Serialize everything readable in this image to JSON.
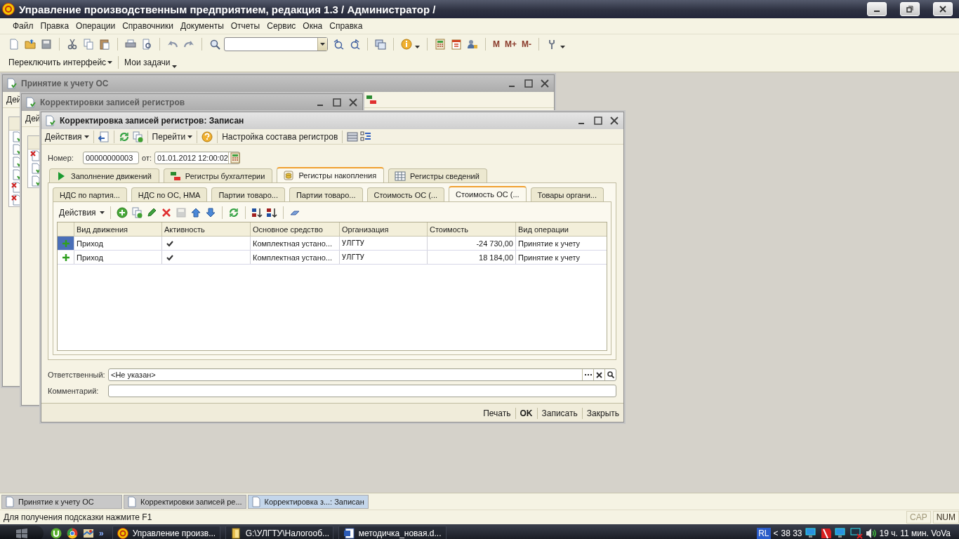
{
  "app": {
    "title": "Управление производственным предприятием, редакция 1.3 / Администратор /"
  },
  "menu": [
    "Файл",
    "Правка",
    "Операции",
    "Справочники",
    "Документы",
    "Отчеты",
    "Сервис",
    "Окна",
    "Справка"
  ],
  "memory_buttons": [
    "M",
    "M+",
    "M-"
  ],
  "panel": [
    "Переключить интерфейс",
    "Мои задачи"
  ],
  "windows": [
    {
      "title": "Принятие к учету ОС",
      "toolbar": "Дей",
      "rows": [
        {
          "marked": false
        },
        {
          "marked": false
        },
        {
          "marked": false
        },
        {
          "marked": false
        },
        {
          "marked": true
        },
        {
          "marked": true
        }
      ]
    },
    {
      "title": "Корректировки записей регистров",
      "toolbar": "Дей",
      "rows": [
        {
          "marked": true
        },
        {
          "marked": false
        },
        {
          "marked": false
        }
      ]
    }
  ],
  "form": {
    "title": "Корректировка записей регистров: Записан",
    "toolbar": [
      "Действия",
      "Перейти",
      "Настройка состава регистров"
    ],
    "number": {
      "label": "Номер:",
      "value": "00000000003"
    },
    "date": {
      "label": "от:",
      "value": "01.01.2012 12:00:02"
    },
    "tabs": [
      {
        "label": "Заполнение движений",
        "selected": false
      },
      {
        "label": "Регистры бухгалтерии",
        "selected": false
      },
      {
        "label": "Регистры накопления",
        "selected": true
      },
      {
        "label": "Регистры сведений",
        "selected": false
      }
    ],
    "subtabs": [
      {
        "label": "НДС по партия...",
        "selected": false
      },
      {
        "label": "НДС по ОС, НМА",
        "selected": false
      },
      {
        "label": "Партии товаро...",
        "selected": false
      },
      {
        "label": "Партии товаро...",
        "selected": false
      },
      {
        "label": "Стоимость ОС (...",
        "selected": false
      },
      {
        "label": "Стоимость ОС (...",
        "selected": true
      },
      {
        "label": "Товары органи...",
        "selected": false
      }
    ],
    "grid": {
      "actions": "Действия",
      "columns": [
        "Вид движения",
        "Активность",
        "Основное средство",
        "Организация",
        "Стоимость",
        "Вид операции"
      ],
      "rows": [
        {
          "selected": true,
          "movement": "Приход",
          "active": true,
          "asset": "Комплектная устано...",
          "organization": "УЛГТУ",
          "cost": "-24 730,00",
          "operation": "Принятие к учету"
        },
        {
          "selected": false,
          "movement": "Приход",
          "active": true,
          "asset": "Комплектная устано...",
          "organization": "УЛГТУ",
          "cost": "18 184,00",
          "operation": "Принятие к учету"
        }
      ]
    },
    "responsible": {
      "label": "Ответственный:",
      "value": "<Не указан>"
    },
    "comment": {
      "label": "Комментарий:"
    },
    "buttons": [
      {
        "label": "Печать",
        "default": false
      },
      {
        "label": "OK",
        "default": true
      },
      {
        "label": "Записать",
        "default": false
      },
      {
        "label": "Закрыть",
        "default": false
      }
    ]
  },
  "window_tabs": [
    {
      "label": "Принятие к учету ОС",
      "selected": false
    },
    {
      "label": "Корректировки записей ре...",
      "selected": false
    },
    {
      "label": "Корректировка з...: Записан",
      "selected": true
    }
  ],
  "status": {
    "hint": "Для получения подсказки нажмите F1",
    "indicators": [
      {
        "label": "CAP",
        "on": false
      },
      {
        "label": "NUM",
        "on": true
      }
    ]
  },
  "taskbar": {
    "chevron": "»",
    "tasks": [
      "Управление произв...",
      "G:\\УЛГТУ\\Налогооб...",
      "методичка_новая.d..."
    ],
    "tray": {
      "language": "RL",
      "chevron": "<",
      "counter": "38 33",
      "clock": "19 ч. 11 мин. VoVa"
    }
  }
}
